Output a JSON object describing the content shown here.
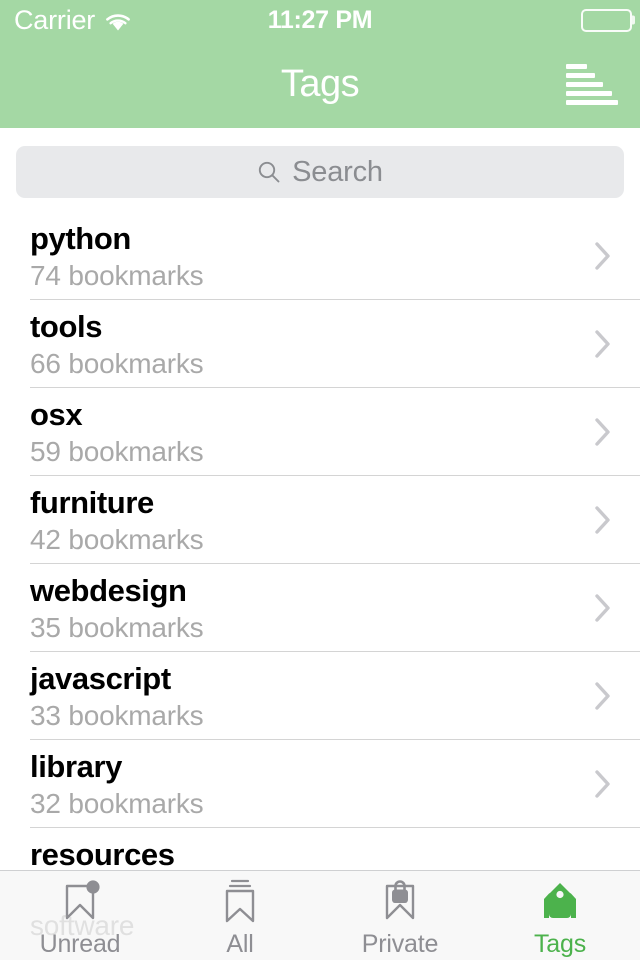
{
  "status_bar": {
    "carrier": "Carrier",
    "wifi_icon": "wifi-icon",
    "time": "11:27 PM",
    "battery_icon": "battery-icon"
  },
  "nav_bar": {
    "title": "Tags",
    "background_color": "#a4d8a4",
    "title_color": "#ffffff",
    "sort_button": {
      "icon": "sort-lines-icon",
      "label": "Sort"
    }
  },
  "search": {
    "placeholder": "Search",
    "value": "",
    "icon": "search-icon",
    "background_color": "#e8e9eb"
  },
  "list": {
    "rows": [
      {
        "tag": "python",
        "count": "74 bookmarks",
        "chevron": "chevron-right-icon"
      },
      {
        "tag": "tools",
        "count": "66 bookmarks",
        "chevron": "chevron-right-icon"
      },
      {
        "tag": "osx",
        "count": "59 bookmarks",
        "chevron": "chevron-right-icon"
      },
      {
        "tag": "furniture",
        "count": "42 bookmarks",
        "chevron": "chevron-right-icon"
      },
      {
        "tag": "webdesign",
        "count": "35 bookmarks",
        "chevron": "chevron-right-icon"
      },
      {
        "tag": "javascript",
        "count": "33 bookmarks",
        "chevron": "chevron-right-icon"
      },
      {
        "tag": "library",
        "count": "32 bookmarks",
        "chevron": "chevron-right-icon"
      },
      {
        "tag": "resources",
        "count": "software",
        "chevron": "chevron-right-icon"
      }
    ]
  },
  "tab_bar": {
    "active_color": "#4cb24c",
    "inactive_color": "#8e8e93",
    "tabs": [
      {
        "label": "Unread",
        "icon": "bookmark-badge-icon",
        "active": false
      },
      {
        "label": "All",
        "icon": "bookmark-stack-icon",
        "active": false
      },
      {
        "label": "Private",
        "icon": "bookmark-lock-icon",
        "active": false
      },
      {
        "label": "Tags",
        "icon": "tags-icon",
        "active": true
      }
    ]
  }
}
